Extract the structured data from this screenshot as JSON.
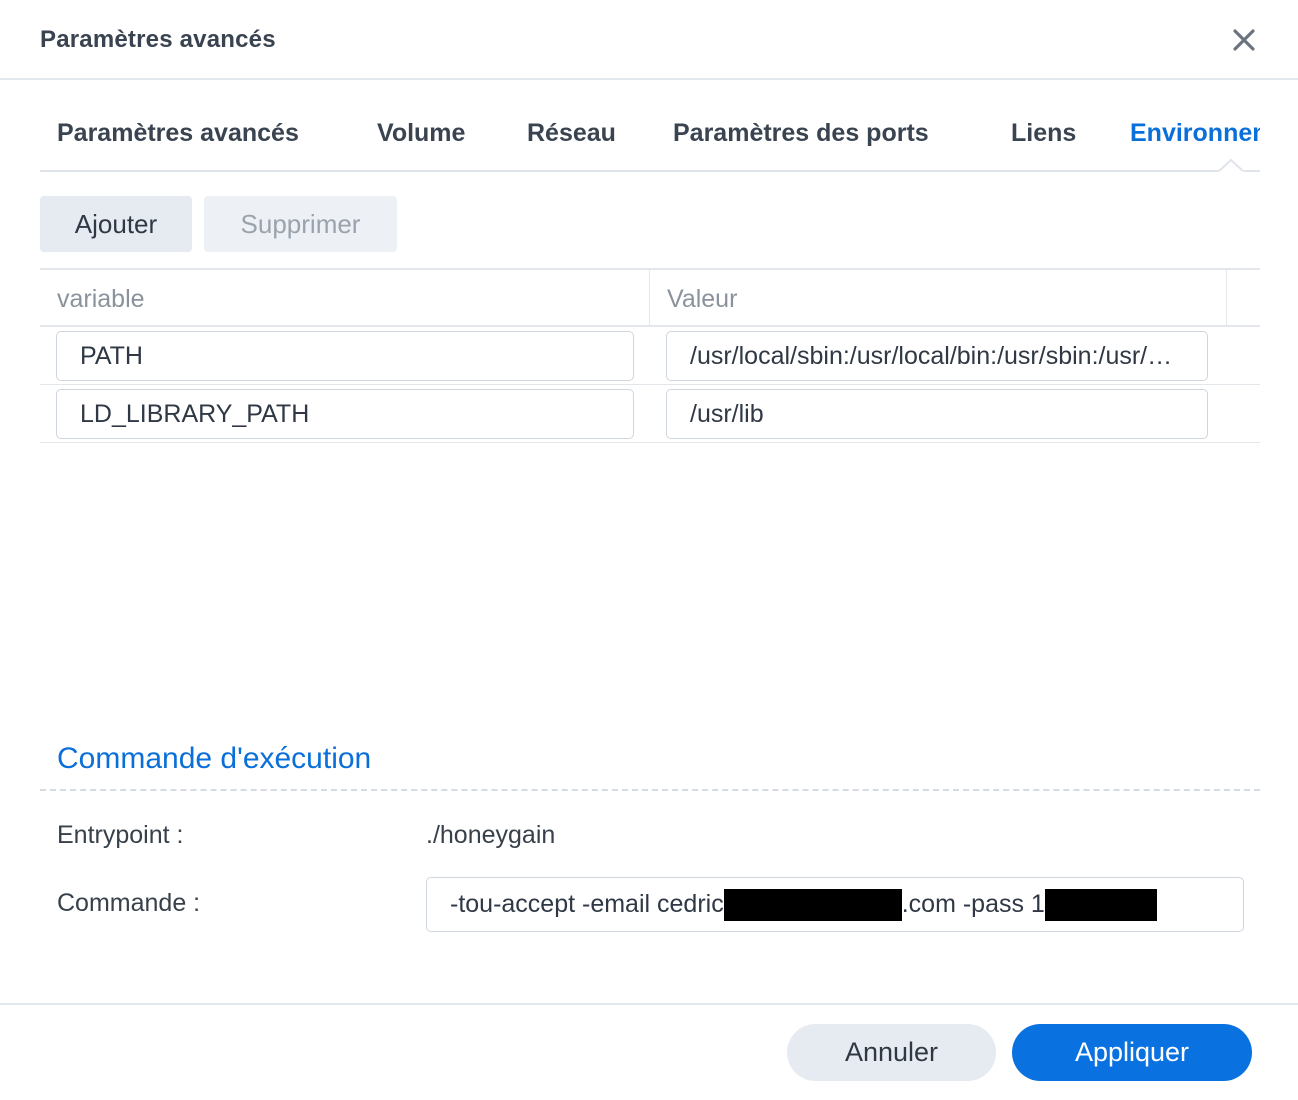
{
  "dialog": {
    "title": "Paramètres avancés",
    "close_icon": "close-icon"
  },
  "tabs": [
    {
      "label": "Paramètres avancés",
      "active": false
    },
    {
      "label": "Volume",
      "active": false
    },
    {
      "label": "Réseau",
      "active": false
    },
    {
      "label": "Paramètres des ports",
      "active": false
    },
    {
      "label": "Liens",
      "active": false
    },
    {
      "label": "Environnement",
      "active": true
    }
  ],
  "toolbar": {
    "add_label": "Ajouter",
    "delete_label": "Supprimer"
  },
  "env_table": {
    "headers": [
      "variable",
      "Valeur"
    ],
    "rows": [
      {
        "variable": "PATH",
        "value": "/usr/local/sbin:/usr/local/bin:/usr/sbin:/usr/bin:/sbin:/bin"
      },
      {
        "variable": "LD_LIBRARY_PATH",
        "value": "/usr/lib"
      }
    ]
  },
  "exec": {
    "section_title": "Commande d'exécution",
    "entrypoint_label": "Entrypoint :",
    "entrypoint_value": "./honeygain",
    "command_label": "Commande :",
    "command_part1": "-tou-accept -email cedric",
    "command_part2": ".com -pass 1"
  },
  "footer": {
    "cancel_label": "Annuler",
    "apply_label": "Appliquer"
  },
  "colors": {
    "accent": "#0a72e0",
    "active_tab": "#0a6fd8",
    "button_bg": "#e6ebf1"
  }
}
